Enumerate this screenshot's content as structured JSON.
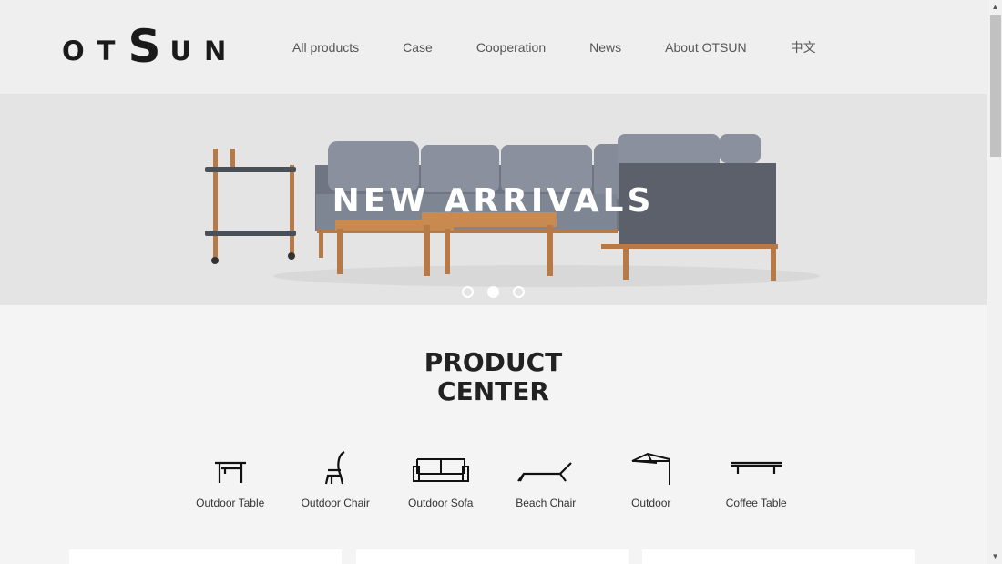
{
  "brand": {
    "logo_small_1": "O",
    "logo_small_2": "T",
    "logo_big": "S",
    "logo_small_3": "U",
    "logo_small_4": "N"
  },
  "nav": {
    "items": [
      "All products",
      "Case",
      "Cooperation",
      "News",
      "About OTSUN",
      "中文"
    ]
  },
  "banner": {
    "title": "NEW ARRIVALS",
    "slide_count": 3,
    "active_slide": 2
  },
  "product_center": {
    "title_line1": "PRODUCT",
    "title_line2": "CENTER",
    "categories": [
      {
        "label": "Outdoor Table",
        "icon": "outdoor-table-icon"
      },
      {
        "label": "Outdoor Chair",
        "icon": "outdoor-chair-icon"
      },
      {
        "label": "Outdoor Sofa",
        "icon": "outdoor-sofa-icon"
      },
      {
        "label": "Beach Chair",
        "icon": "beach-chair-icon"
      },
      {
        "label": "Outdoor",
        "icon": "outdoor-umbrella-icon"
      },
      {
        "label": "Coffee Table",
        "icon": "coffee-table-icon"
      }
    ]
  },
  "colors": {
    "background": "#f4f4f4",
    "header_bg": "#efefef",
    "banner_bg": "#e4e4e4",
    "text_dark": "#222222",
    "sofa_gray": "#7e8593",
    "wood": "#b67a48"
  }
}
